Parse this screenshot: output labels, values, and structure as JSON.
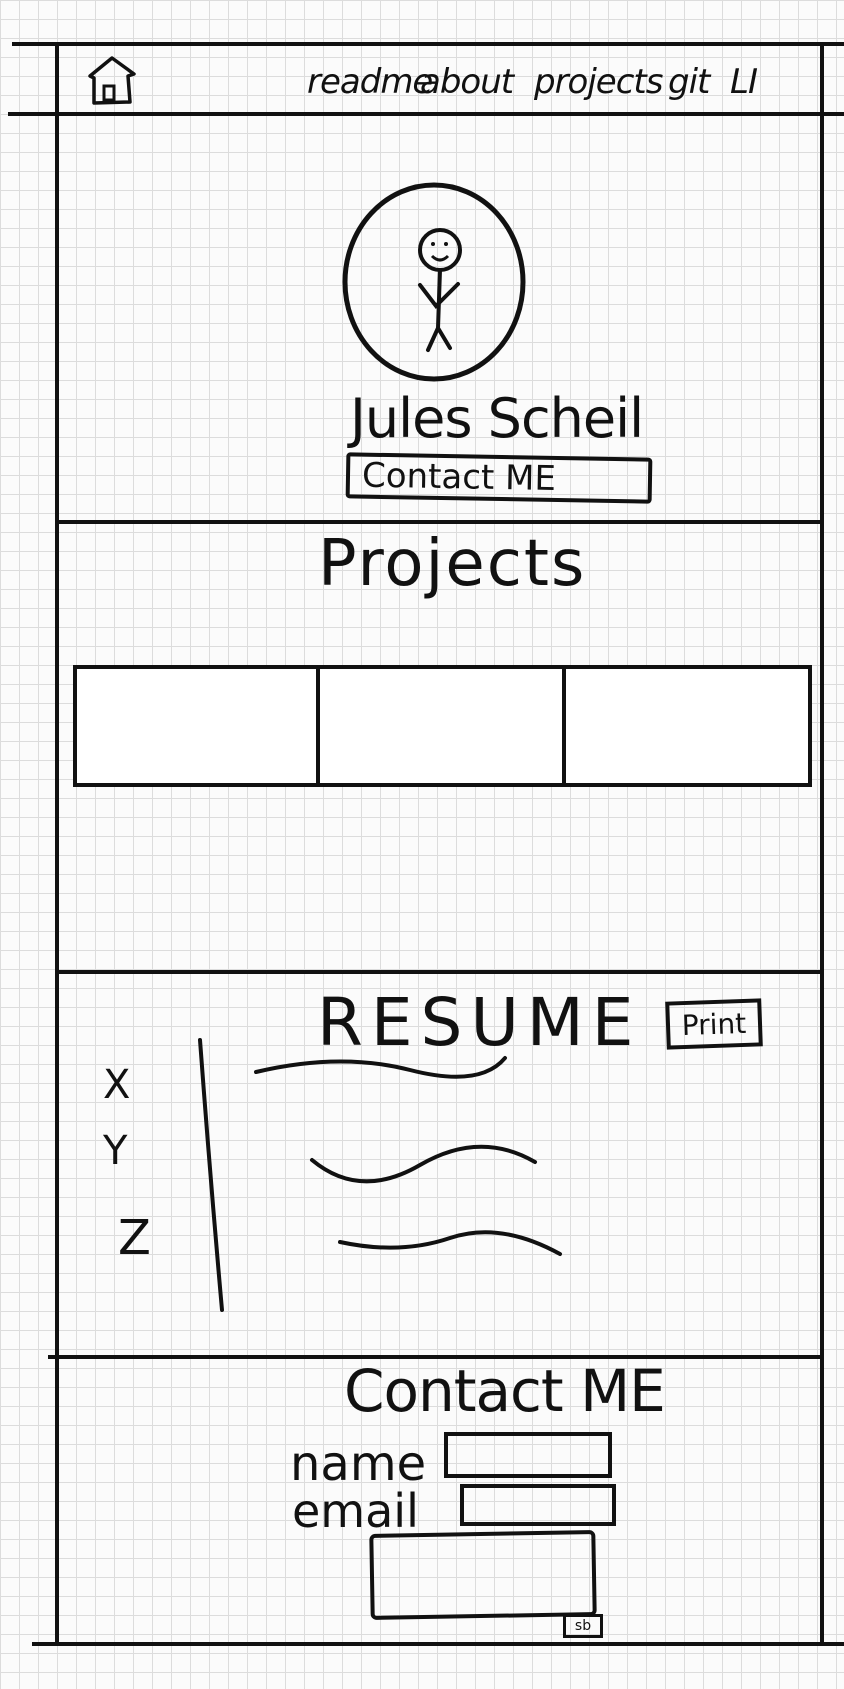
{
  "nav": {
    "links": [
      "readme",
      "about",
      "projects",
      "git",
      "LI"
    ]
  },
  "hero": {
    "name": "Jules Scheil",
    "contact_button": "Contact ME"
  },
  "projects": {
    "title": "Projects"
  },
  "resume": {
    "title": "RESUME",
    "print_button": "Print",
    "side_marks": [
      "X",
      "Y",
      "Z"
    ]
  },
  "contact": {
    "title": "Contact ME",
    "name_label": "name",
    "email_label": "email",
    "submit_label": "sb"
  }
}
